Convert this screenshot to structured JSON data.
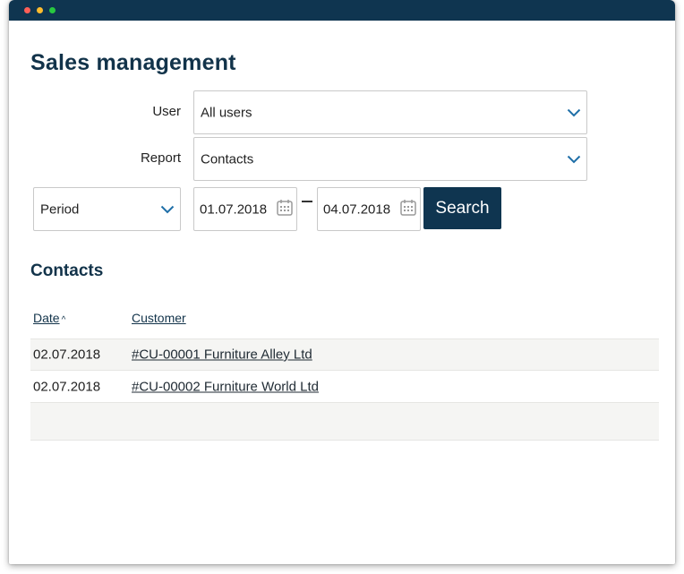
{
  "page": {
    "title": "Sales management"
  },
  "filters": {
    "user": {
      "label": "User",
      "value": "All users"
    },
    "report": {
      "label": "Report",
      "value": "Contacts"
    },
    "period": {
      "value": "Period"
    },
    "date_from": "01.07.2018",
    "date_separator": "–",
    "date_to": "04.07.2018",
    "search_label": "Search"
  },
  "contacts": {
    "title": "Contacts",
    "columns": {
      "date": "Date",
      "customer": "Customer"
    },
    "sort_indicator": "^",
    "rows": [
      {
        "date": "02.07.2018",
        "customer": "#CU-00001 Furniture Alley Ltd"
      },
      {
        "date": "02.07.2018",
        "customer": "#CU-00002 Furniture World Ltd"
      }
    ]
  },
  "colors": {
    "brand": "#0f3550",
    "chevron": "#1f6fa8",
    "row_alt": "#f5f5f3"
  },
  "icons": [
    "chevron-down-icon",
    "calendar-icon",
    "sort-up-icon"
  ]
}
